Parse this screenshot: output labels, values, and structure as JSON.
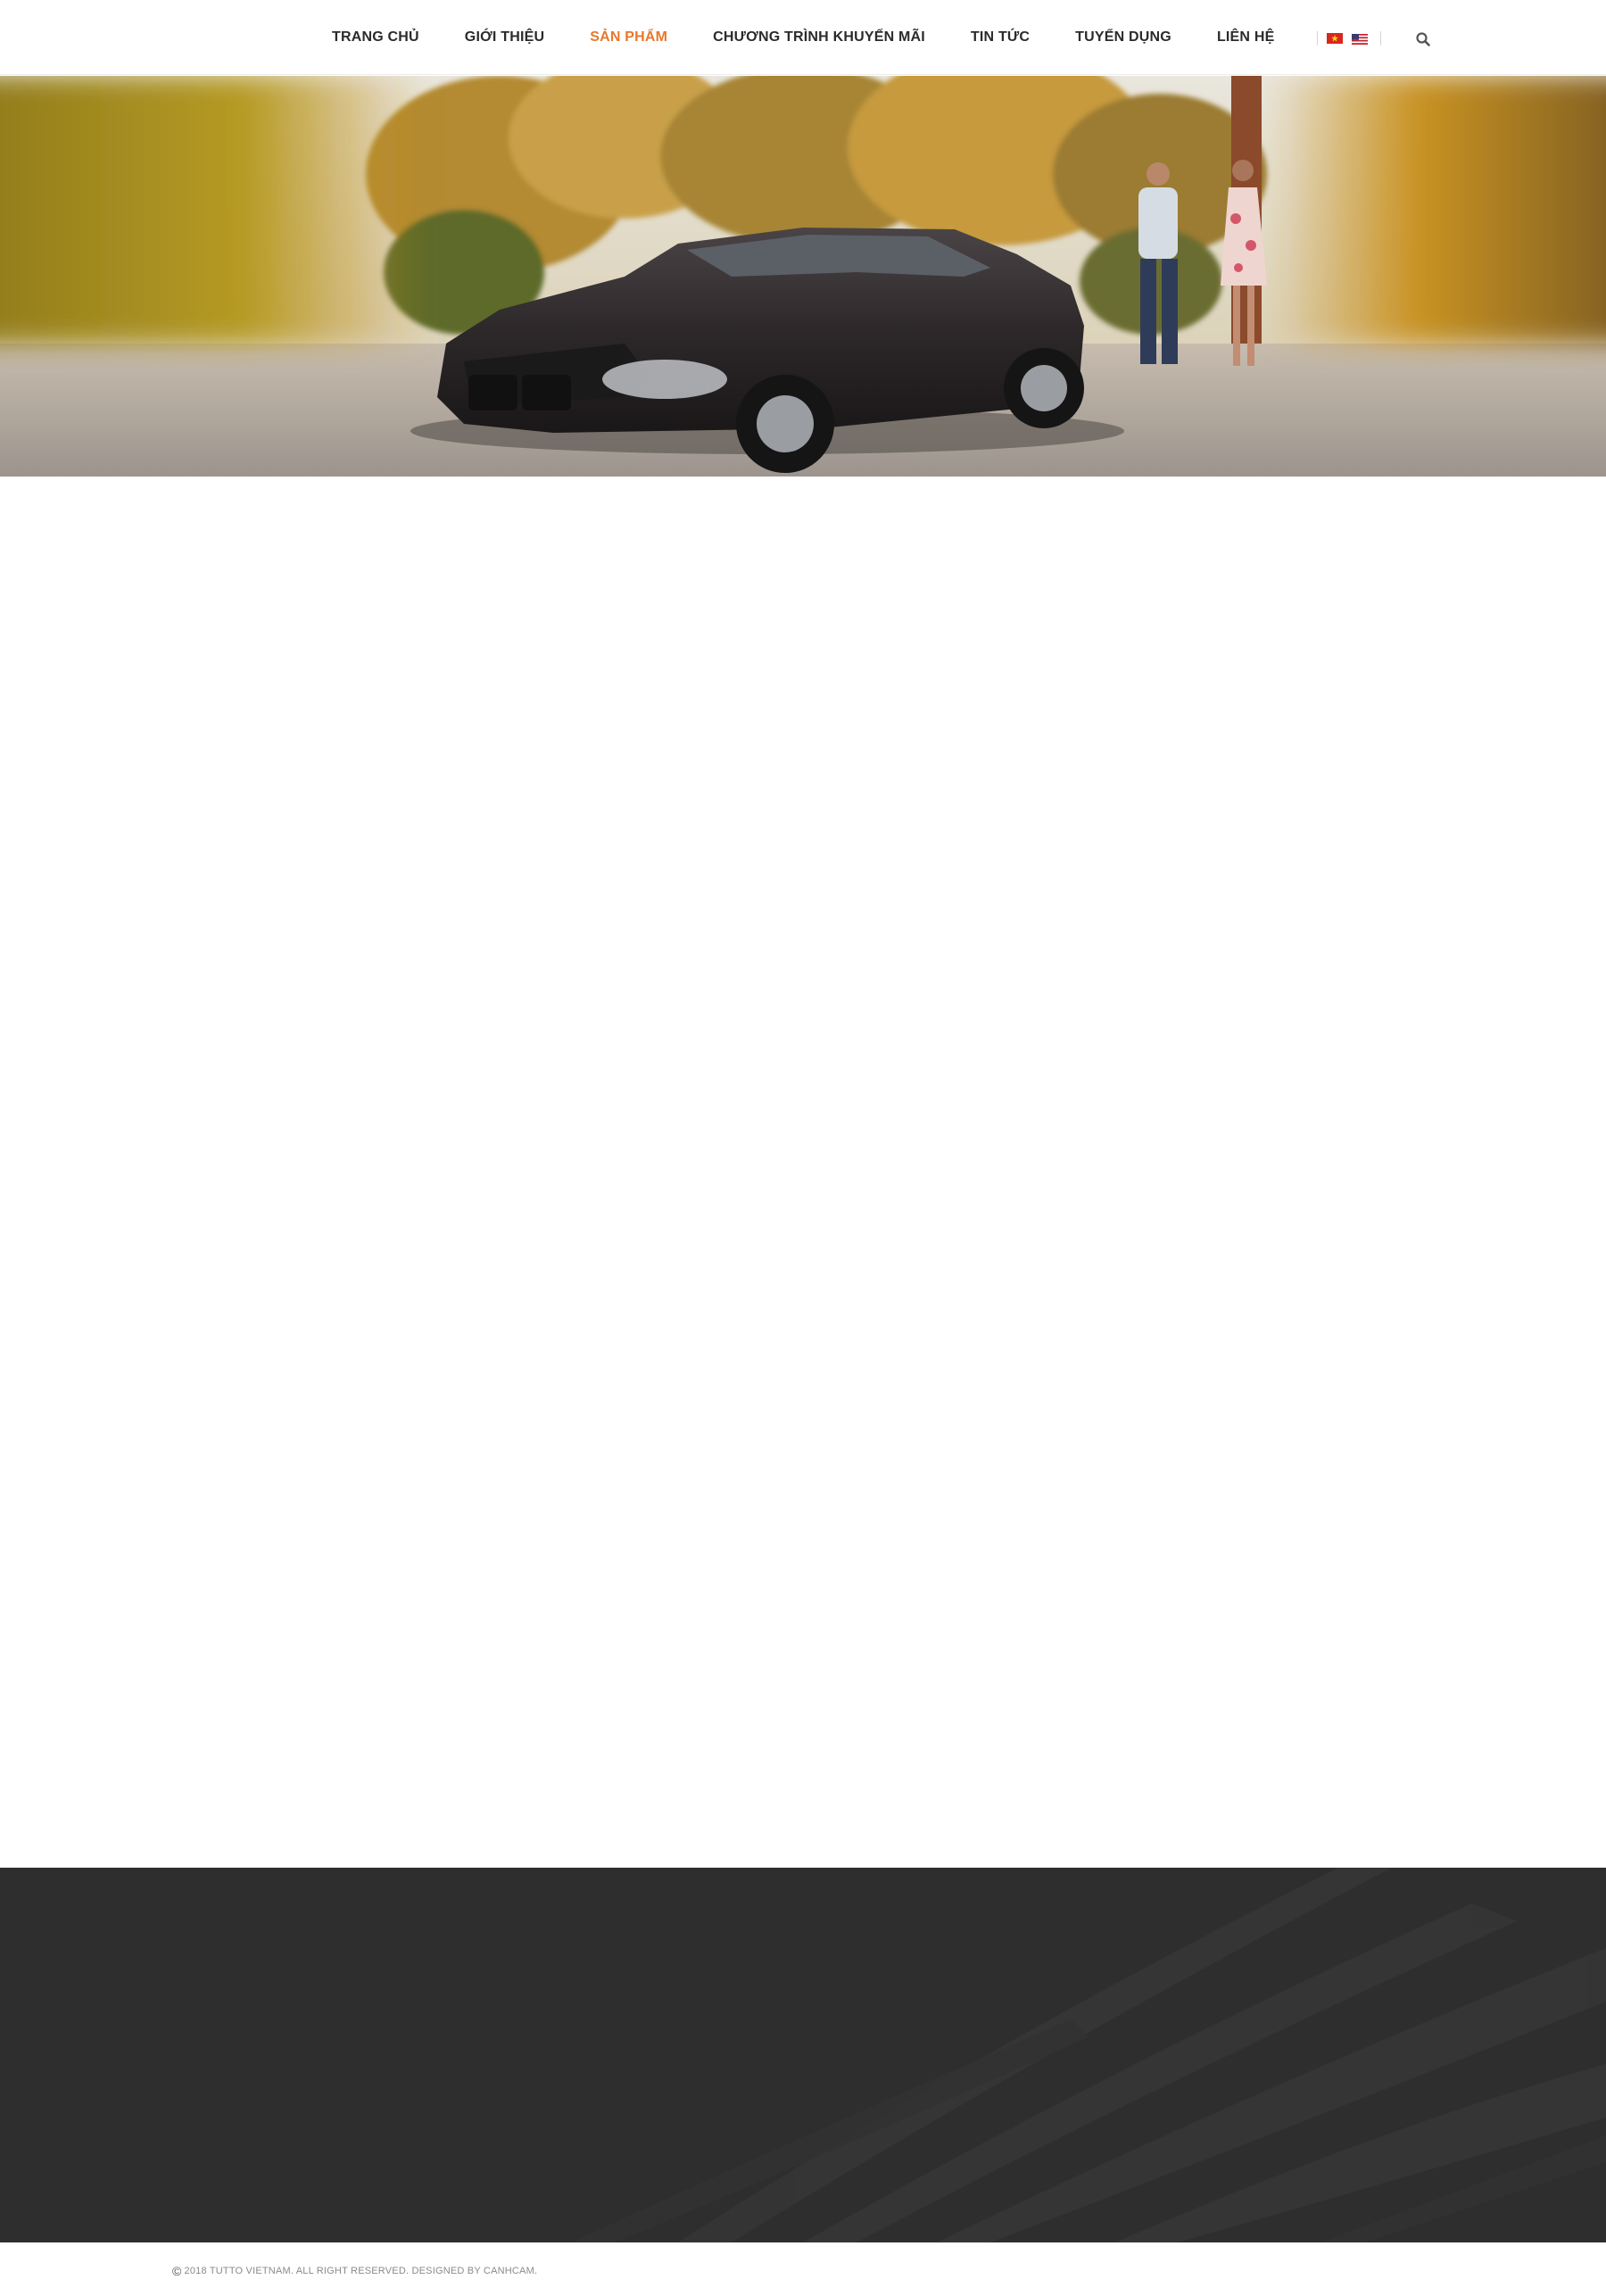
{
  "header": {
    "nav": [
      {
        "label": "TRANG CHỦ",
        "active": false
      },
      {
        "label": "GIỚI THIỆU",
        "active": false
      },
      {
        "label": "SẢN PHẨM",
        "active": true
      },
      {
        "label": "CHƯƠNG TRÌNH KHUYẾN MÃI",
        "active": false
      },
      {
        "label": "TIN TỨC",
        "active": false
      },
      {
        "label": "TUYỂN DỤNG",
        "active": false
      },
      {
        "label": "LIÊN HỆ",
        "active": false
      }
    ],
    "languages": [
      {
        "icon": "vietnam-flag-icon"
      },
      {
        "icon": "us-flag-icon"
      }
    ],
    "search_icon": "search-icon"
  },
  "hero": {
    "image": "dark sedan parked with couple walking beside it"
  },
  "footer": {
    "copyright_symbol": "©",
    "copyright": "2018 TUTTO VIETNAM. ALL RIGHT RESERVED. DESIGNED BY CANHCAM."
  },
  "colors": {
    "accent": "#e8782b",
    "nav_text": "#2b2b2b",
    "footer_bg": "#2e2e2e",
    "copyright_text": "#8a8a8a"
  }
}
